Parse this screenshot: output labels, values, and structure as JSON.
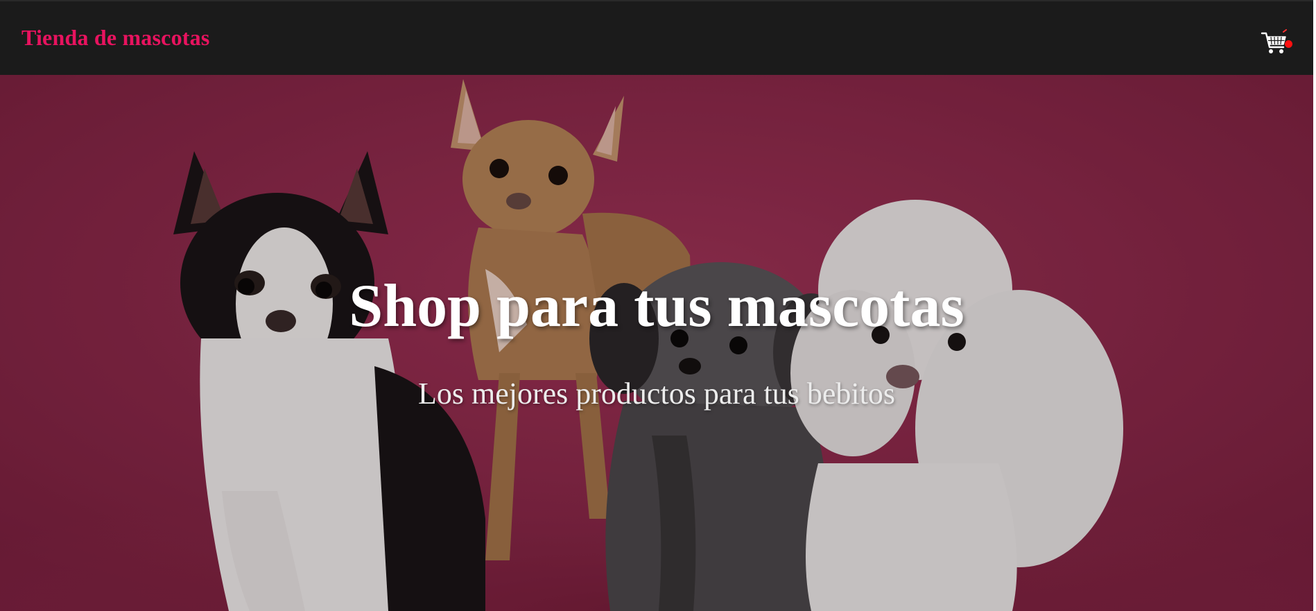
{
  "navbar": {
    "brand": "Tienda de mascotas",
    "cart_icon": "shopping-cart-icon",
    "cart_indicator_color": "#ff1010"
  },
  "hero": {
    "title": "Shop para tus mascotas",
    "subtitle": "Los mejores productos para tus bebitos",
    "background_color": "#8f2a4b",
    "image_subject": "four small dogs on pink background"
  },
  "colors": {
    "navbar_bg": "#1b1b1b",
    "brand": "#e8135f",
    "hero_text": "#ffffff"
  }
}
